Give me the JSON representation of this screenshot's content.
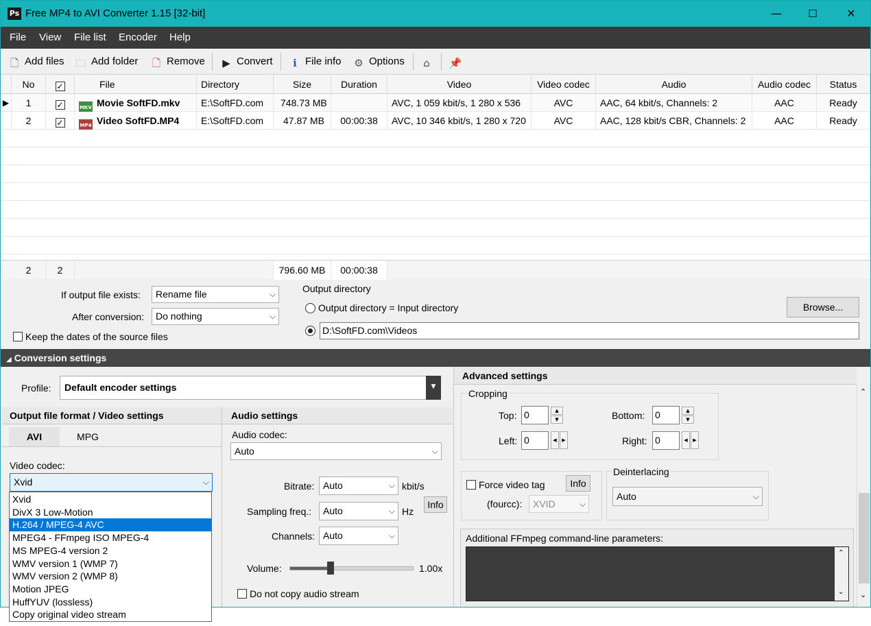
{
  "window": {
    "icon_text": "Ps",
    "title": "Free MP4 to AVI Converter 1.15  [32-bit]",
    "minimize": "—",
    "maximize": "☐",
    "close": "✕"
  },
  "menu": [
    "File",
    "View",
    "File list",
    "Encoder",
    "Help"
  ],
  "toolbar": {
    "add_files": "Add files",
    "add_folder": "Add folder",
    "remove": "Remove",
    "convert": "Convert",
    "file_info": "File info",
    "options": "Options"
  },
  "grid": {
    "columns": [
      "No",
      "",
      "File",
      "Directory",
      "Size",
      "Duration",
      "Video",
      "Video codec",
      "Audio",
      "Audio codec",
      "Status"
    ],
    "rows": [
      {
        "no": "1",
        "checked": true,
        "badge": "MKV",
        "file": "Movie SoftFD.mkv",
        "directory": "E:\\SoftFD.com",
        "size": "748.73 MB",
        "duration": "",
        "video": "AVC, 1 059 kbit/s, 1 280 x 536",
        "video_codec": "AVC",
        "audio": "AAC, 64 kbit/s, Channels: 2",
        "audio_codec": "AAC",
        "status": "Ready"
      },
      {
        "no": "2",
        "checked": true,
        "badge": "MP4",
        "file": "Video SoftFD.MP4",
        "directory": "E:\\SoftFD.com",
        "size": "47.87 MB",
        "duration": "00:00:38",
        "video": "AVC, 10 346 kbit/s, 1 280 x 720",
        "video_codec": "AVC",
        "audio": "AAC, 128 kbit/s CBR, Channels: 2",
        "audio_codec": "AAC",
        "status": "Ready"
      }
    ],
    "footer": {
      "count": "2",
      "checked": "2",
      "size": "796.60 MB",
      "duration": "00:00:38"
    }
  },
  "output": {
    "if_exists_label": "If output file exists:",
    "if_exists_value": "Rename file",
    "after_label": "After conversion:",
    "after_value": "Do nothing",
    "keep_dates": "Keep the dates of the source files",
    "dir_title": "Output directory",
    "dir_same": "Output directory = Input directory",
    "dir_path": "D:\\SoftFD.com\\Videos",
    "browse": "Browse..."
  },
  "conversion": {
    "title": "Conversion settings",
    "profile_label": "Profile:",
    "profile_value": "Default encoder settings",
    "format_title": "Output file format / Video settings",
    "tab_avi": "AVI",
    "tab_mpg": "MPG",
    "video_codec_label": "Video codec:",
    "video_codec_value": "Xvid",
    "codec_options": [
      "Xvid",
      "DivX 3 Low-Motion",
      "H.264 / MPEG-4 AVC",
      "MPEG4 - FFmpeg ISO MPEG-4",
      "MS MPEG-4 version 2",
      "WMV version 1 (WMP 7)",
      "WMV version 2 (WMP 8)",
      "Motion JPEG",
      "HuffYUV (lossless)",
      "Copy original video stream"
    ],
    "codec_selected_index": 2
  },
  "audio": {
    "title": "Audio settings",
    "codec_label": "Audio codec:",
    "codec_value": "Auto",
    "bitrate_label": "Bitrate:",
    "bitrate_value": "Auto",
    "bitrate_unit": "kbit/s",
    "freq_label": "Sampling freq.:",
    "freq_value": "Auto",
    "freq_unit": "Hz",
    "info": "Info",
    "channels_label": "Channels:",
    "channels_value": "Auto",
    "volume_label": "Volume:",
    "volume_value": "1.00x",
    "volume_fraction": 0.33,
    "no_copy": "Do not copy audio stream"
  },
  "advanced": {
    "title": "Advanced settings",
    "cropping": "Cropping",
    "top_label": "Top:",
    "top_value": "0",
    "bottom_label": "Bottom:",
    "bottom_value": "0",
    "left_label": "Left:",
    "left_value": "0",
    "right_label": "Right:",
    "right_value": "0",
    "force_tag": "Force video tag",
    "fourcc_label": "(fourcc):",
    "fourcc_value": "XVID",
    "info": "Info",
    "deinterlacing": "Deinterlacing",
    "deinterlacing_value": "Auto",
    "ffmpeg_label": "Additional FFmpeg command-line parameters:"
  }
}
